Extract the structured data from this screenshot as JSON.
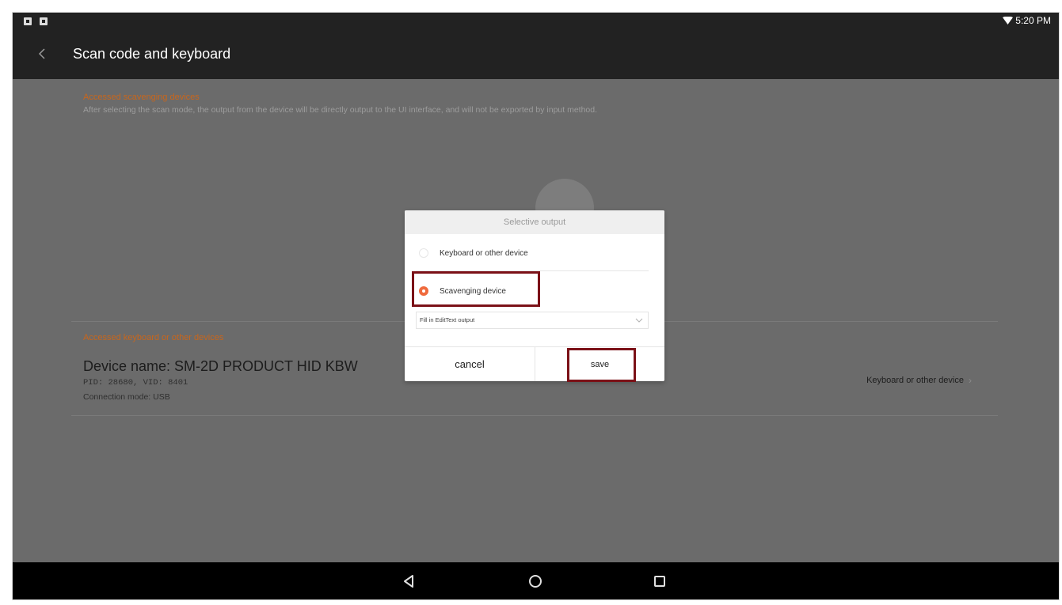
{
  "status_bar": {
    "time": "5:20 PM",
    "icons": [
      "image-icon",
      "notification-icon",
      "wifi-icon"
    ]
  },
  "app_bar": {
    "title": "Scan code and keyboard",
    "back_icon": "chevron-left-icon"
  },
  "scanner_section": {
    "label": "Accessed scavenging devices",
    "description": "After selecting the scan mode, the output from the device will be directly output to the UI interface, and will not be exported by input method."
  },
  "keyboard_section": {
    "label": "Accessed keyboard or other devices",
    "device_name": "Device name: SM-2D PRODUCT HID KBW",
    "ids": "PID: 28680, VID: 8401",
    "connection": "Connection mode: USB",
    "output_mode": "Keyboard or other device"
  },
  "dialog": {
    "title": "Selective output",
    "options": [
      {
        "label": "Keyboard or other device",
        "selected": false
      },
      {
        "label": "Scavenging device",
        "selected": true
      }
    ],
    "dropdown_value": "Fill in EditText output",
    "cancel_label": "cancel",
    "save_label": "save"
  },
  "nav_bar": {
    "icons": [
      "back-icon",
      "home-icon",
      "recents-icon"
    ]
  },
  "colors": {
    "accent": "#ef6a3d",
    "section_label": "#c8661c",
    "highlight": "#7b1117",
    "overlay": "#6b6b6b",
    "bar": "#222222"
  }
}
